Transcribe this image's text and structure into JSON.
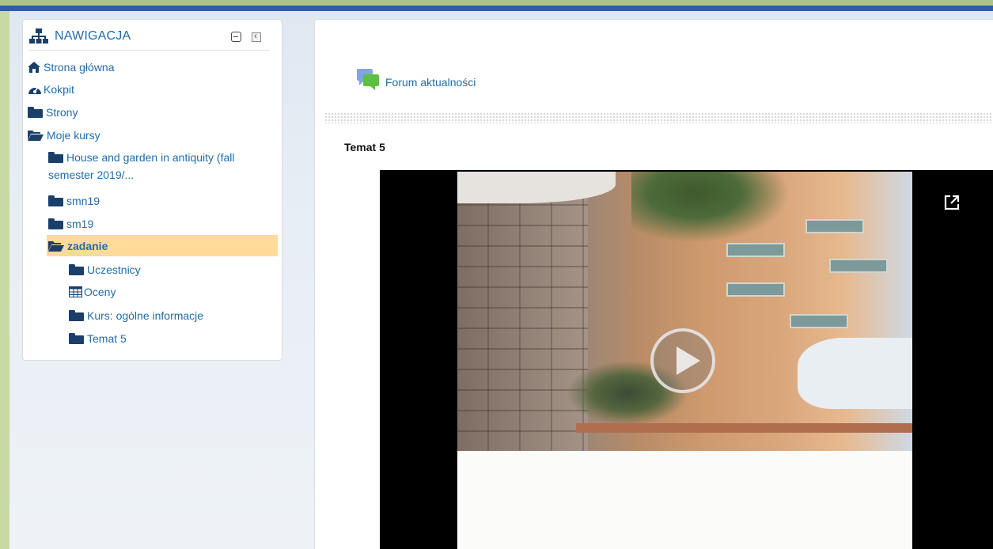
{
  "nav": {
    "title": "NAWIGACJA",
    "items": [
      {
        "label": "Strona główna",
        "icon": "home-icon"
      },
      {
        "label": "Kokpit",
        "icon": "dashboard-icon"
      },
      {
        "label": "Strony",
        "icon": "folder-icon"
      },
      {
        "label": "Moje kursy",
        "icon": "folder-open-icon"
      },
      {
        "label": "House and garden in antiquity (fall semester 2019/...",
        "icon": "folder-icon"
      },
      {
        "label": "smn19",
        "icon": "folder-icon"
      },
      {
        "label": "sm19",
        "icon": "folder-icon"
      },
      {
        "label": "zadanie",
        "icon": "folder-open-icon",
        "active": true
      },
      {
        "label": "Uczestnicy",
        "icon": "folder-icon"
      },
      {
        "label": "Oceny",
        "icon": "table-icon"
      },
      {
        "label": "Kurs: ogólne informacje",
        "icon": "folder-icon"
      },
      {
        "label": "Temat 5",
        "icon": "folder-icon"
      }
    ]
  },
  "main": {
    "forum_link": "Forum aktualności",
    "section_title": "Temat 5"
  },
  "colors": {
    "link": "#1f6bab",
    "active_highlight": "#ffdb99",
    "page_border": "#c9d9a4",
    "top_bar": "#2e5ea6"
  }
}
